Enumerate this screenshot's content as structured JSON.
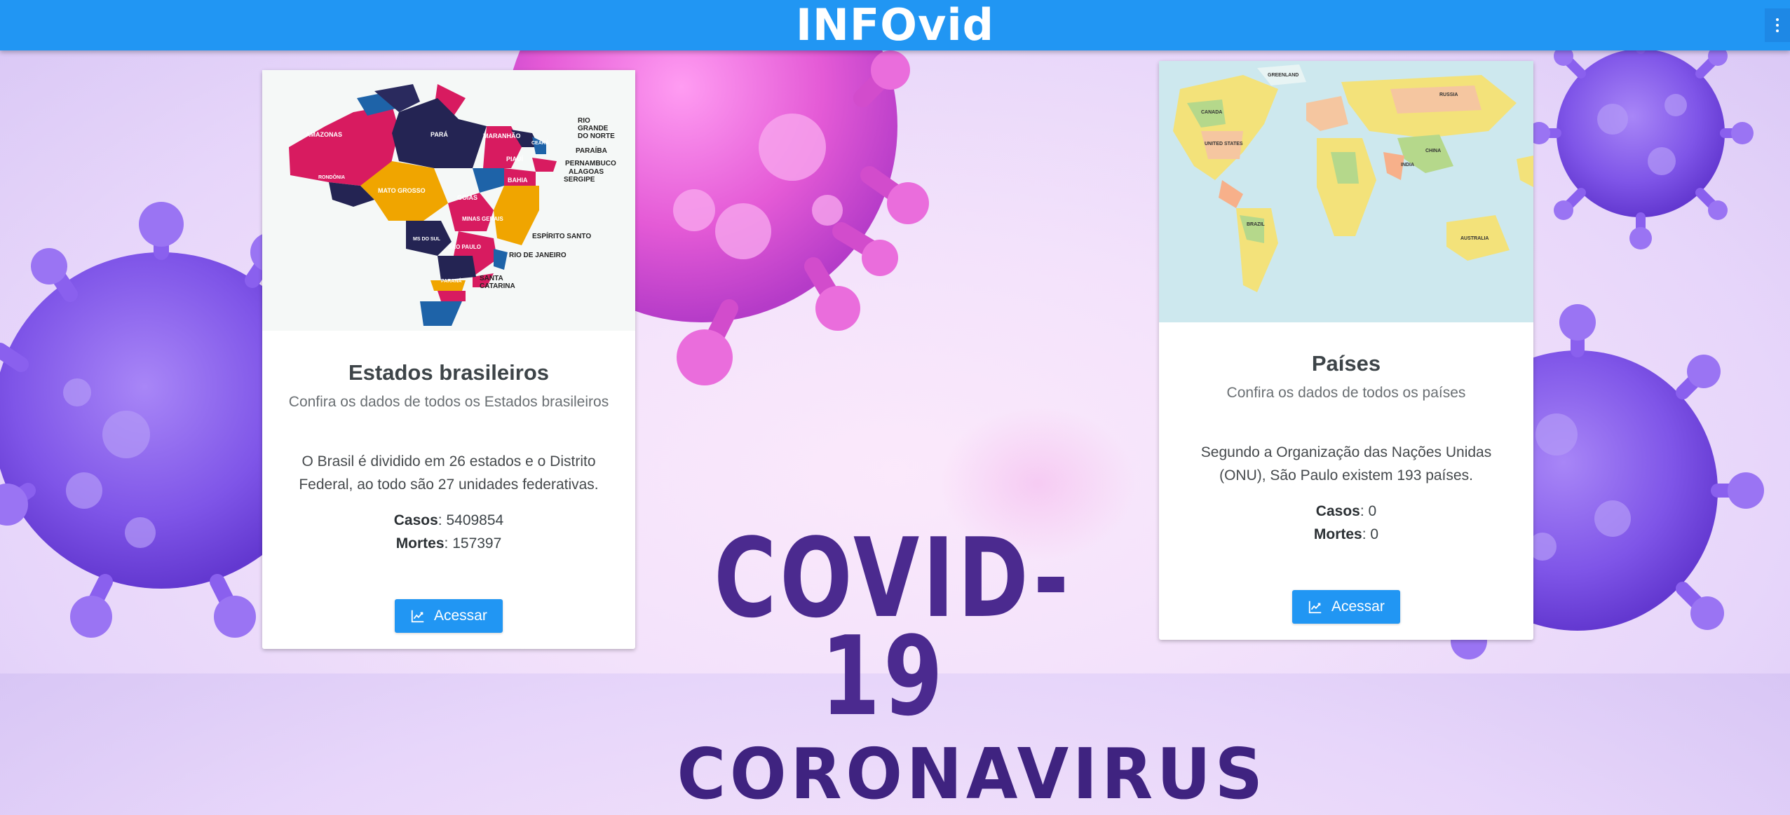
{
  "app": {
    "brand": "INFOvid",
    "menu_icon": "more-vertical-icon"
  },
  "hero": {
    "title": "COVID-19",
    "subtitle": "CORONAVIRUS"
  },
  "cards": {
    "brazil": {
      "image_icon": "brazil-states-map",
      "map_labels": [
        "AMAZONAS",
        "PARÁ",
        "MARANHÃO",
        "CEARÁ",
        "RIO GRANDE DO NORTE",
        "PARAÍBA",
        "PERNAMBUCO",
        "ALAGOAS",
        "SERGIPE",
        "PIAUÍ",
        "BAHIA",
        "MATO GROSSO",
        "GOIÁS",
        "RONDÔNIA",
        "MINAS GERAIS",
        "ESPÍRITO SANTO",
        "RIO DE JANEIRO",
        "SÃO PAULO",
        "PARANÁ",
        "SANTA CATARINA",
        "MS DO SUL"
      ],
      "title": "Estados brasileiros",
      "subtitle": "Confira os dados de todos os Estados brasileiros",
      "description": "O Brasil é dividido em 26 estados e o Distrito Federal, ao todo são 27 unidades federativas.",
      "cases_label": "Casos",
      "cases_value": ": 5409854",
      "deaths_label": "Mortes",
      "deaths_value": ": 157397",
      "button_label": "Acessar",
      "button_icon": "chart-line-icon"
    },
    "world": {
      "image_icon": "world-political-map",
      "map_labels": [
        "GREENLAND",
        "RUSSIA",
        "CANADA",
        "UNITED STATES",
        "BRAZIL",
        "CHINA",
        "INDIA",
        "AUSTRALIA"
      ],
      "title": "Países",
      "subtitle": "Confira os dados de todos os países",
      "description": "Segundo a Organização das Nações Unidas (ONU), São Paulo existem 193 países.",
      "cases_label": "Casos",
      "cases_value": ": 0",
      "deaths_label": "Mortes",
      "deaths_value": ": 0",
      "button_label": "Acessar",
      "button_icon": "chart-line-icon"
    }
  },
  "colors": {
    "primary": "#2196f3",
    "virus_purple": "#8a5cf0",
    "virus_pink": "#f06fe0",
    "headline": "#4b2a8f"
  }
}
